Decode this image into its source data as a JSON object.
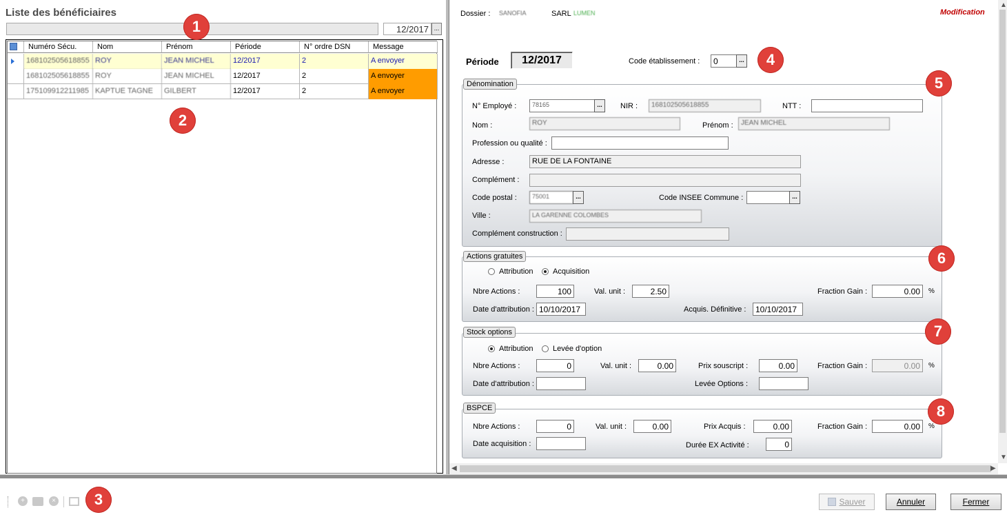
{
  "left": {
    "title": "Liste des bénéficiaires",
    "period": "12/2017",
    "picker_label": "...",
    "columns": [
      "Numéro Sécu.",
      "Nom",
      "Prénom",
      "Période",
      "N° ordre DSN",
      "Message"
    ],
    "rows": [
      {
        "secu": "168102505618855",
        "nom": "ROY",
        "prenom": "JEAN MICHEL",
        "periode": "12/2017",
        "ordre": "2",
        "message": "A envoyer"
      },
      {
        "secu": "168102505618855",
        "nom": "ROY",
        "prenom": "JEAN MICHEL",
        "periode": "12/2017",
        "ordre": "2",
        "message": "A envoyer"
      },
      {
        "secu": "175109912211985",
        "nom": "KAPTUE TAGNE",
        "prenom": "GILBERT",
        "periode": "12/2017",
        "ordre": "2",
        "message": "A envoyer"
      }
    ]
  },
  "header": {
    "dossier_label": "Dossier :",
    "dossier_value": "SANOFIA",
    "company_label": "SARL",
    "company_value": "LUMEN",
    "mode": "Modification"
  },
  "periode": {
    "label": "Période",
    "value": "12/2017"
  },
  "etablissement": {
    "label": "Code établissement :",
    "value": "0"
  },
  "denomination": {
    "title": "Dénomination",
    "employe_label": "N° Employé :",
    "employe_value": "78165",
    "nir_label": "NIR :",
    "nir_value": "168102505618855",
    "ntt_label": "NTT :",
    "ntt_value": "",
    "nom_label": "Nom :",
    "nom_value": "ROY",
    "prenom_label": "Prénom :",
    "prenom_value": "JEAN MICHEL",
    "profession_label": "Profession ou qualité :",
    "profession_value": "",
    "adresse_label": "Adresse :",
    "adresse_value": "RUE DE LA FONTAINE",
    "complement_label": "Complément :",
    "complement_value": "",
    "cp_label": "Code postal :",
    "cp_value": "75001",
    "insee_label": "Code INSEE Commune :",
    "insee_value": "",
    "ville_label": "Ville :",
    "ville_value": "LA GARENNE COLOMBES",
    "construction_label": "Complément construction :",
    "construction_value": ""
  },
  "actions": {
    "title": "Actions gratuites",
    "radio1": "Attribution",
    "radio2": "Acquisition",
    "selected": "Acquisition",
    "nbre_label": "Nbre Actions :",
    "nbre_value": "100",
    "val_label": "Val. unit :",
    "val_value": "2.50",
    "fraction_label": "Fraction Gain :",
    "fraction_value": "0.00",
    "pct": "%",
    "date_label": "Date d'attribution :",
    "date_value": "10/10/2017",
    "acquis_label": "Acquis. Définitive :",
    "acquis_value": "10/10/2017"
  },
  "stock": {
    "title": "Stock options",
    "radio1": "Attribution",
    "radio2": "Levée d'option",
    "selected": "Attribution",
    "nbre_label": "Nbre Actions :",
    "nbre_value": "0",
    "val_label": "Val. unit :",
    "val_value": "0.00",
    "prix_label": "Prix  souscript :",
    "prix_value": "0.00",
    "fraction_label": "Fraction Gain :",
    "fraction_value": "0.00",
    "pct": "%",
    "date_label": "Date d'attribution :",
    "date_value": "",
    "levee_label": "Levée Options :",
    "levee_value": ""
  },
  "bspce": {
    "title": "BSPCE",
    "nbre_label": "Nbre Actions :",
    "nbre_value": "0",
    "val_label": "Val. unit :",
    "val_value": "0.00",
    "prix_label": "Prix  Acquis :",
    "prix_value": "0.00",
    "fraction_label": "Fraction Gain :",
    "fraction_value": "0.00",
    "pct": "%",
    "date_label": "Date acquisition :",
    "date_value": "",
    "duree_label": "Durée EX Activité :",
    "duree_value": "0"
  },
  "badges": [
    "1",
    "2",
    "3",
    "4",
    "5",
    "6",
    "7",
    "8"
  ],
  "buttons": {
    "sauver": "Sauver",
    "annuler": "Annuler",
    "fermer": "Fermer"
  },
  "colors": {
    "accent_red": "#e0403a",
    "message_orange": "#ff9c00",
    "selected_row": "#ffffd2",
    "mode_red": "#c00000"
  }
}
